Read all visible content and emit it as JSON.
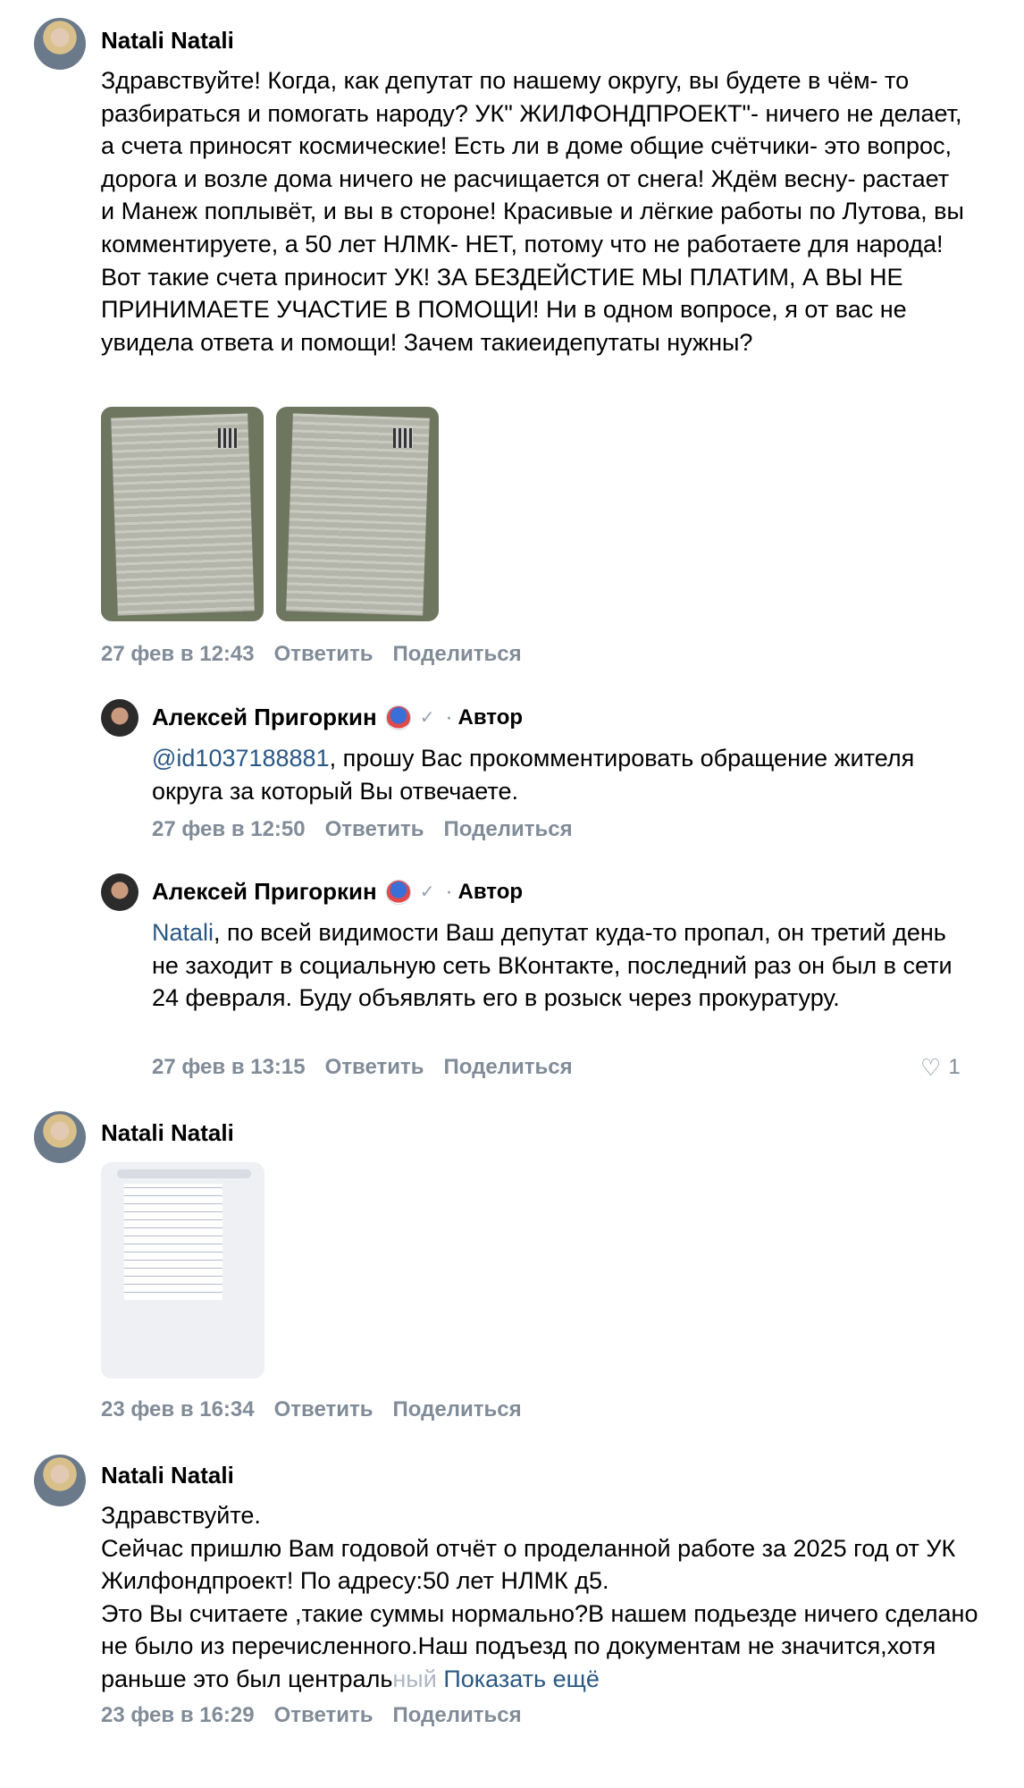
{
  "comments": [
    {
      "author": "Natali Natali",
      "text": "Здравствуйте! Когда, как депутат по нашему округу, вы будете в чём- то разбираться и помогать народу? УК\" ЖИЛФОНДПРОЕКТ\"- ничего не делает, а счета приносят космические! Есть ли в доме общие счётчики- это вопрос, дорога и возле дома ничего не расчищается от снега! Ждём весну- растает и Манеж поплывёт, и вы в стороне! Красивые и лёгкие работы по Лутова, вы комментируете, а 50 лет НЛМК- НЕТ, потому что не работаете для народа! Вот такие счета приносит УК! ЗА БЕЗДЕЙСТИЕ МЫ ПЛАТИМ, А ВЫ НЕ ПРИНИМАЕТЕ УЧАСТИЕ В ПОМОЩИ! Ни в одном вопросе, я от вас не увидела ответа и помощи! Зачем такиеидепутаты нужны?",
      "date": "27 фев в 12:43",
      "reply_label": "Ответить",
      "share_label": "Поделиться"
    },
    {
      "author": "Алексей Пригоркин",
      "author_tag": "Автор",
      "mention": "@id1037188881",
      "text": ", прошу Вас прокомментировать обращение жителя округа за который Вы отвечаете.",
      "date": "27 фев в 12:50",
      "reply_label": "Ответить",
      "share_label": "Поделиться"
    },
    {
      "author": "Алексей Пригоркин",
      "author_tag": "Автор",
      "mention": "Natali",
      "text": ", по всей видимости Ваш депутат куда-то пропал, он третий день не заходит в социальную сеть ВКонтакте, последний раз он был в сети 24 февраля. Буду объявлять его в розыск через прокуратуру.",
      "date": "27 фев в 13:15",
      "reply_label": "Ответить",
      "share_label": "Поделиться",
      "likes": "1"
    },
    {
      "author": "Natali Natali",
      "date": "23 фев в 16:34",
      "reply_label": "Ответить",
      "share_label": "Поделиться"
    },
    {
      "author": "Natali Natali",
      "line1": "Здравствуйте.",
      "text_main": "Сейчас пришлю Вам годовой отчёт о проделанной работе за 2025 год от УК Жилфондпроект! По адресу:50 лет НЛМК д5.\nЭто Вы считаете ,такие суммы нормально?В нашем подьезде ничего сделано не было из перечисленного.Наш подъезд по документам не значится,хотя раньше это был централь",
      "text_fade": "ный",
      "show_more": "Показать ещё",
      "date": "23 фев в 16:29",
      "reply_label": "Ответить",
      "share_label": "Поделиться"
    }
  ],
  "icons": {
    "badge": "vk-fan-badge-icon",
    "verified": "check-icon",
    "like": "heart-icon"
  }
}
